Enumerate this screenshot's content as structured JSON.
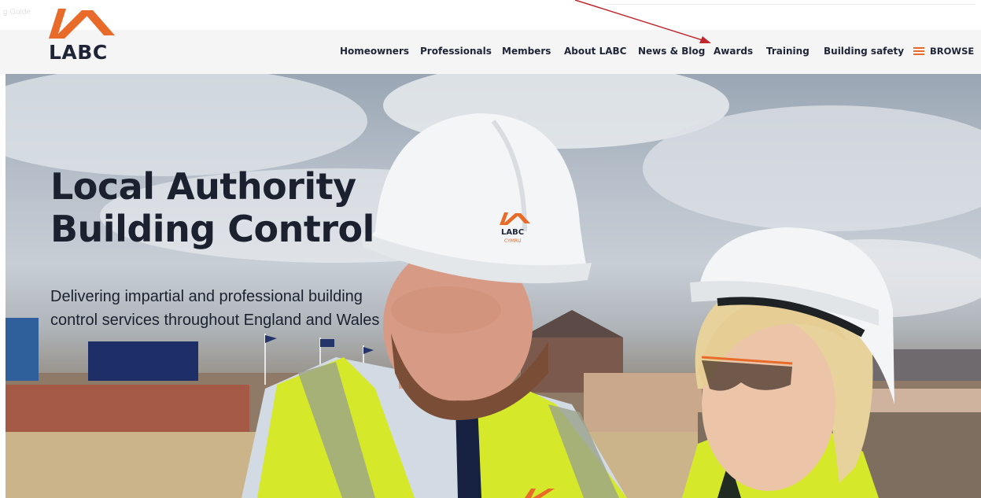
{
  "browser": {
    "faint_text": "g Guide"
  },
  "brand": {
    "logo_text": "LABC",
    "accent_color": "#e86b2a",
    "text_color": "#1f2436"
  },
  "nav": {
    "items": [
      {
        "label": "Homeowners"
      },
      {
        "label": "Professionals"
      },
      {
        "label": "Members"
      },
      {
        "label": "About LABC"
      },
      {
        "label": "News & Blog"
      },
      {
        "label": "Awards"
      },
      {
        "label": "Training"
      },
      {
        "label": "Building safety"
      }
    ],
    "browse_label": "BROWSE",
    "browse_icon": "hamburger-menu-icon"
  },
  "hero": {
    "title_line1": "Local Authority",
    "title_line2": "Building Control",
    "subtitle": "Delivering impartial and professional building control services throughout England and Wales",
    "helmet_logo_text": "LABC",
    "helmet_logo_subtext": "CYMRU"
  },
  "annotation": {
    "color": "#c0272d",
    "target": "Awards"
  }
}
